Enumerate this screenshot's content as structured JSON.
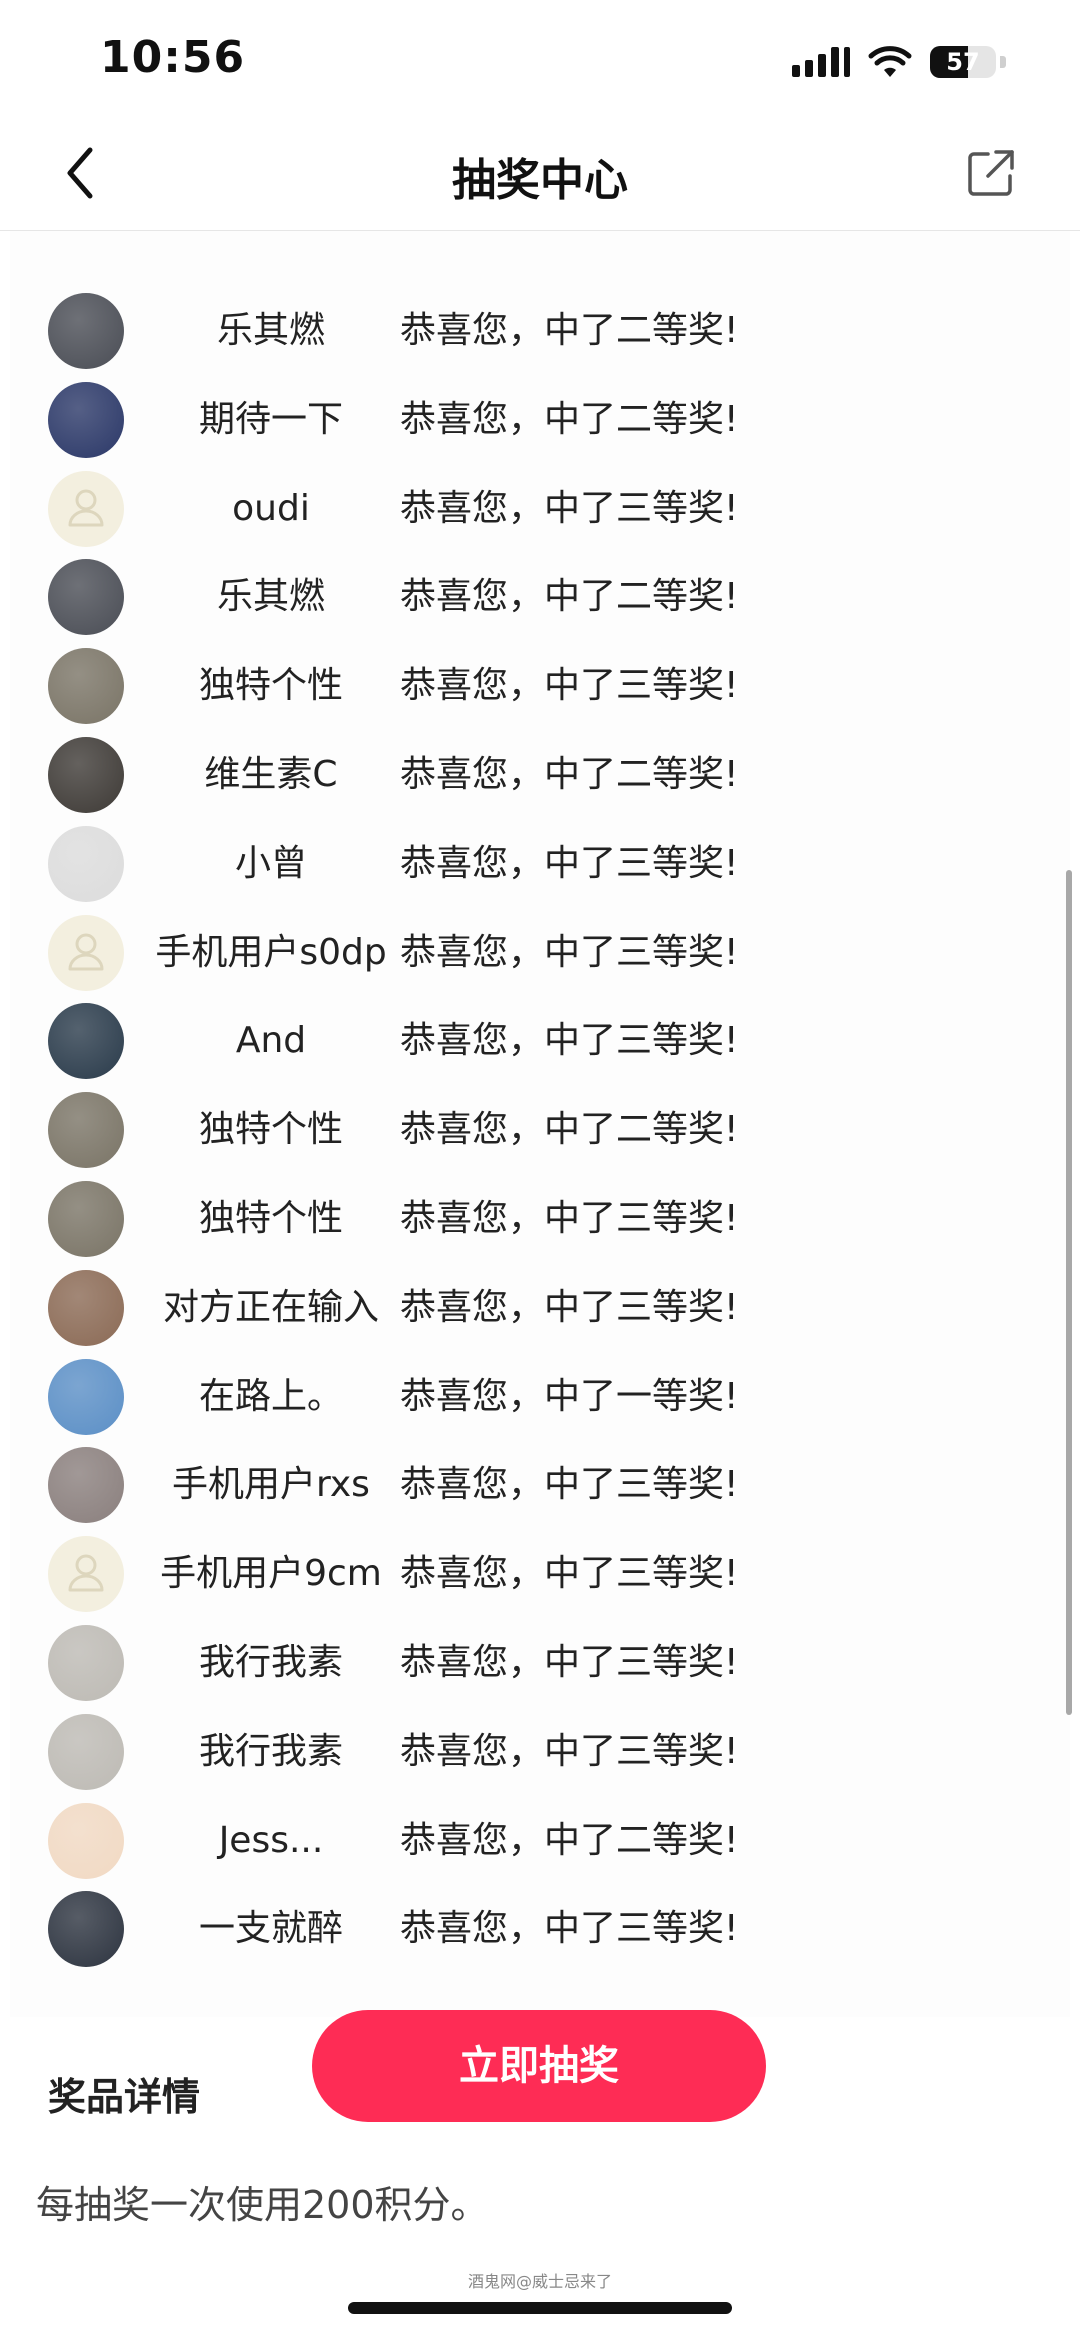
{
  "status_bar": {
    "time": "10:56",
    "battery_level": "57",
    "battery_fraction": 0.57
  },
  "header": {
    "title": "抽奖中心",
    "back_icon": "chevron-left-icon",
    "share_icon": "share-external-icon"
  },
  "winners": [
    {
      "name": "乐其燃",
      "message": "恭喜您，中了二等奖!",
      "avatar": "photo-dark-helmet",
      "avatar_color": "#4a4d55"
    },
    {
      "name": "期待一下",
      "message": "恭喜您，中了二等奖!",
      "avatar": "photo-night-city",
      "avatar_color": "#2b3868"
    },
    {
      "name": "oudi",
      "message": "恭喜您，中了三等奖!",
      "avatar": "default-user-icon",
      "avatar_color": "#f3efdf"
    },
    {
      "name": "乐其燃",
      "message": "恭喜您，中了二等奖!",
      "avatar": "photo-dark-helmet",
      "avatar_color": "#4a4d55"
    },
    {
      "name": "独特个性",
      "message": "恭喜您，中了三等奖!",
      "avatar": "photo-sketch-figure",
      "avatar_color": "#7a7466"
    },
    {
      "name": "维生素C",
      "message": "恭喜您，中了二等奖!",
      "avatar": "photo-girl-portrait",
      "avatar_color": "#3e3a36"
    },
    {
      "name": "小曾",
      "message": "恭喜您，中了三等奖!",
      "avatar": "photo-black-hat",
      "avatar_color": "#dcdcdc"
    },
    {
      "name": "手机用户s0dp",
      "message": "恭喜您，中了三等奖!",
      "avatar": "default-user-icon",
      "avatar_color": "#f3efdf"
    },
    {
      "name": "And",
      "message": "恭喜您，中了三等奖!",
      "avatar": "photo-dark-figure",
      "avatar_color": "#2a3b4b"
    },
    {
      "name": "独特个性",
      "message": "恭喜您，中了二等奖!",
      "avatar": "photo-sketch-figure",
      "avatar_color": "#7a7466"
    },
    {
      "name": "独特个性",
      "message": "恭喜您，中了三等奖!",
      "avatar": "photo-sketch-figure",
      "avatar_color": "#7a7466"
    },
    {
      "name": "对方正在输入",
      "message": "恭喜您，中了三等奖!",
      "avatar": "photo-dog-sunset",
      "avatar_color": "#8b6a55"
    },
    {
      "name": "在路上。",
      "message": "恭喜您，中了一等奖!",
      "avatar": "photo-sky-sea",
      "avatar_color": "#5b8fc6"
    },
    {
      "name": "手机用户rxs",
      "message": "恭喜您，中了三等奖!",
      "avatar": "photo-bare-trees",
      "avatar_color": "#8a7f7d"
    },
    {
      "name": "手机用户9cm",
      "message": "恭喜您，中了三等奖!",
      "avatar": "default-user-icon",
      "avatar_color": "#f3efdf"
    },
    {
      "name": "我行我素",
      "message": "恭喜您，中了三等奖!",
      "avatar": "photo-gray-texture",
      "avatar_color": "#bdbab4"
    },
    {
      "name": "我行我素",
      "message": "恭喜您，中了三等奖!",
      "avatar": "photo-gray-texture",
      "avatar_color": "#bdbab4"
    },
    {
      "name": "Jess...",
      "message": "恭喜您，中了二等奖!",
      "avatar": "photo-cartoon-girl",
      "avatar_color": "#f1d9c3"
    },
    {
      "name": "一支就醉",
      "message": "恭喜您，中了三等奖!",
      "avatar": "photo-tshirt-back",
      "avatar_color": "#2d3440"
    }
  ],
  "draw_button": {
    "label": "立即抽奖",
    "color": "#fe2c55"
  },
  "prize_details": {
    "title": "奖品详情",
    "text": "每抽奖一次使用200积分。"
  },
  "watermark": "酒鬼网@威士忌来了"
}
